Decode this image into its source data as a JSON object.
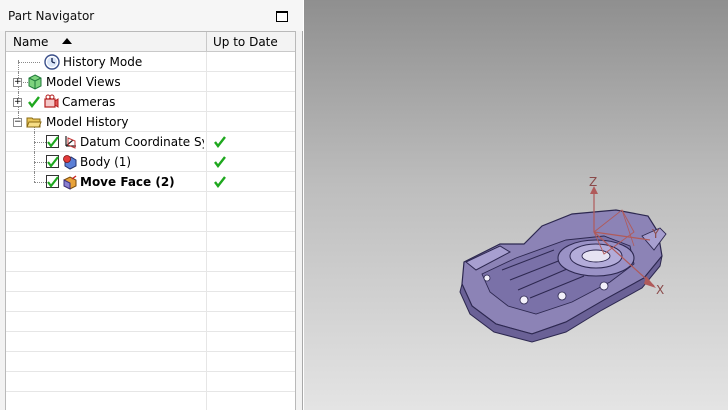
{
  "navigator": {
    "title": "Part Navigator",
    "columns": {
      "name": "Name",
      "up_to_date": "Up to Date"
    },
    "rows": [
      {
        "label": "History Mode",
        "icon": "clock-icon"
      },
      {
        "label": "Model Views",
        "icon": "model-views-icon",
        "expander": "+"
      },
      {
        "label": "Cameras",
        "icon": "cameras-icon",
        "expander": "+"
      },
      {
        "label": "Model History",
        "icon": "folder-open-icon",
        "expander": "−"
      },
      {
        "label": "Datum Coordinate Sy...",
        "icon": "datum-csys-icon",
        "checked": true,
        "up_to_date": true
      },
      {
        "label": "Body (1)",
        "icon": "body-icon",
        "checked": true,
        "up_to_date": true
      },
      {
        "label": "Move Face (2)",
        "icon": "move-face-icon",
        "checked": true,
        "up_to_date": true,
        "bold": true
      }
    ]
  },
  "viewport": {
    "axes": {
      "x": "X",
      "y": "Y",
      "z": "Z"
    },
    "colors": {
      "background_top": "#8f8f8f",
      "background_bottom": "#e4e4e4",
      "part": "#8c83b6",
      "axis": "#b05a5a"
    }
  }
}
